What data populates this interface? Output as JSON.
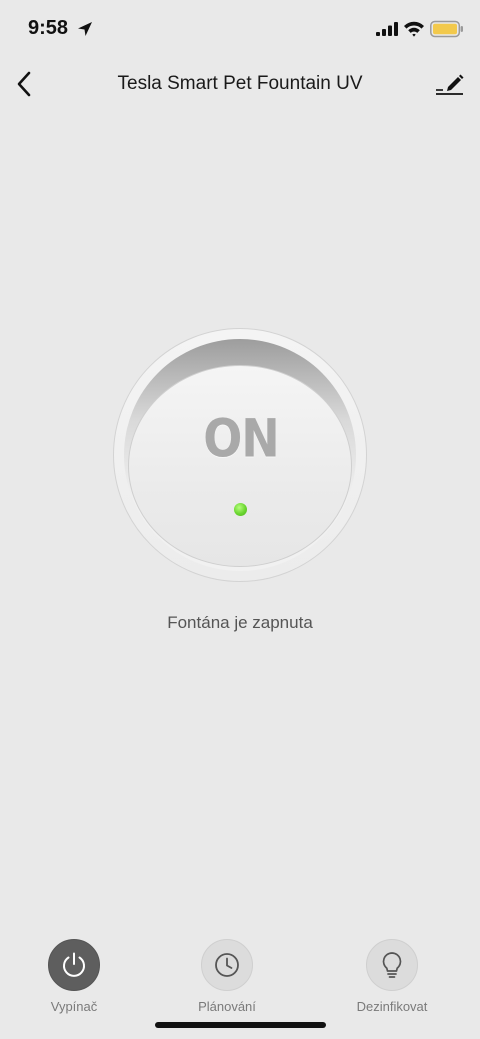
{
  "status_bar": {
    "time": "9:58",
    "icons": [
      "location-arrow-icon",
      "cellular-signal-icon",
      "wifi-icon",
      "battery-icon"
    ],
    "battery_color": "#f2c94c"
  },
  "header": {
    "title": "Tesla Smart Pet Fountain UV",
    "back_icon": "chevron-left-icon",
    "edit_icon": "pencil-edit-icon"
  },
  "power_knob": {
    "label": "ON",
    "indicator_color": "#6ad52f"
  },
  "status_text": "Fontána je zapnuta",
  "bottom_controls": [
    {
      "label": "Vypínač",
      "icon": "power-icon",
      "active": true
    },
    {
      "label": "Plánování",
      "icon": "clock-icon",
      "active": false
    },
    {
      "label": "Dezinfikovat",
      "icon": "lightbulb-icon",
      "active": false
    }
  ]
}
